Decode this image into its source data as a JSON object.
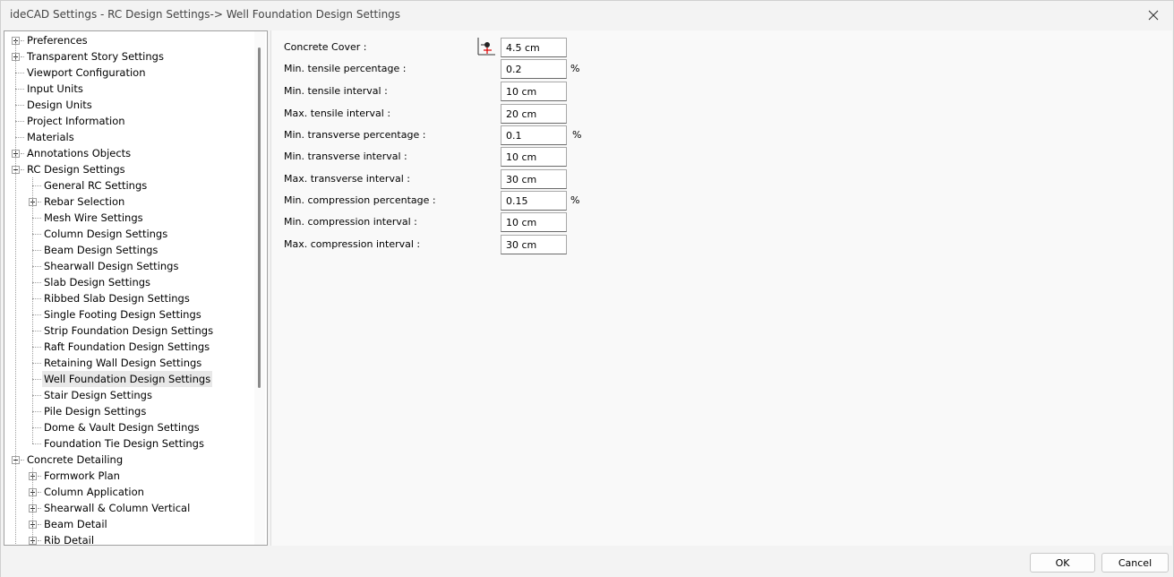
{
  "window": {
    "title": "ideCAD Settings - RC Design Settings-> Well Foundation Design Settings"
  },
  "tree": {
    "items": [
      {
        "label": "Preferences",
        "level": 0,
        "expander": "plus"
      },
      {
        "label": "Transparent Story Settings",
        "level": 0,
        "expander": "plus"
      },
      {
        "label": "Viewport Configuration",
        "level": 0,
        "expander": "none"
      },
      {
        "label": "Input Units",
        "level": 0,
        "expander": "none"
      },
      {
        "label": "Design Units",
        "level": 0,
        "expander": "none"
      },
      {
        "label": "Project Information",
        "level": 0,
        "expander": "none"
      },
      {
        "label": "Materials",
        "level": 0,
        "expander": "none"
      },
      {
        "label": "Annotations Objects",
        "level": 0,
        "expander": "plus"
      },
      {
        "label": "RC Design Settings",
        "level": 0,
        "expander": "minus"
      },
      {
        "label": "General RC Settings",
        "level": 1,
        "expander": "none"
      },
      {
        "label": "Rebar Selection",
        "level": 1,
        "expander": "plus"
      },
      {
        "label": "Mesh Wire Settings",
        "level": 1,
        "expander": "none"
      },
      {
        "label": "Column Design Settings",
        "level": 1,
        "expander": "none"
      },
      {
        "label": "Beam Design Settings",
        "level": 1,
        "expander": "none"
      },
      {
        "label": "Shearwall Design Settings",
        "level": 1,
        "expander": "none"
      },
      {
        "label": "Slab Design Settings",
        "level": 1,
        "expander": "none"
      },
      {
        "label": "Ribbed Slab Design Settings",
        "level": 1,
        "expander": "none"
      },
      {
        "label": "Single Footing Design Settings",
        "level": 1,
        "expander": "none"
      },
      {
        "label": "Strip Foundation Design Settings",
        "level": 1,
        "expander": "none"
      },
      {
        "label": "Raft Foundation Design Settings",
        "level": 1,
        "expander": "none"
      },
      {
        "label": "Retaining Wall Design Settings",
        "level": 1,
        "expander": "none"
      },
      {
        "label": "Well Foundation Design Settings",
        "level": 1,
        "expander": "none",
        "selected": true
      },
      {
        "label": "Stair Design Settings",
        "level": 1,
        "expander": "none"
      },
      {
        "label": "Pile Design Settings",
        "level": 1,
        "expander": "none"
      },
      {
        "label": "Dome & Vault Design Settings",
        "level": 1,
        "expander": "none"
      },
      {
        "label": "Foundation Tie Design Settings",
        "level": 1,
        "expander": "none"
      },
      {
        "label": "Concrete Detailing",
        "level": 0,
        "expander": "minus"
      },
      {
        "label": "Formwork Plan",
        "level": 1,
        "expander": "plus"
      },
      {
        "label": "Column Application",
        "level": 1,
        "expander": "plus"
      },
      {
        "label": "Shearwall & Column Vertical",
        "level": 1,
        "expander": "plus"
      },
      {
        "label": "Beam Detail",
        "level": 1,
        "expander": "plus"
      },
      {
        "label": "Rib Detail",
        "level": 1,
        "expander": "plus"
      }
    ]
  },
  "form": {
    "fields": [
      {
        "name": "concrete-cover",
        "label": "Concrete Cover :",
        "value": "4.5 cm",
        "unit": "",
        "icon": "concrete-cover-icon"
      },
      {
        "name": "min-tensile-percentage",
        "label": "Min. tensile percentage :",
        "value": "0.2",
        "unit": "%"
      },
      {
        "name": "min-tensile-interval",
        "label": "Min. tensile interval :",
        "value": "10 cm",
        "unit": ""
      },
      {
        "name": "max-tensile-interval",
        "label": "Max. tensile interval :",
        "value": "20 cm",
        "unit": ""
      },
      {
        "name": "min-transverse-percentage",
        "label": "Min. transverse percentage :",
        "value": "0.1",
        "unit": "%"
      },
      {
        "name": "min-transverse-interval",
        "label": "Min. transverse interval :",
        "value": "10 cm",
        "unit": ""
      },
      {
        "name": "max-transverse-interval",
        "label": "Max. transverse interval :",
        "value": "30 cm",
        "unit": ""
      },
      {
        "name": "min-compression-percentage",
        "label": "Min. compression percentage :",
        "value": "0.15",
        "unit": "%"
      },
      {
        "name": "min-compression-interval",
        "label": "Min. compression interval :",
        "value": "10 cm",
        "unit": ""
      },
      {
        "name": "max-compression-interval",
        "label": "Max. compression interval :",
        "value": "30 cm",
        "unit": ""
      }
    ]
  },
  "footer": {
    "ok_label": "OK",
    "cancel_label": "Cancel"
  },
  "icons": {
    "close": "close-icon"
  }
}
